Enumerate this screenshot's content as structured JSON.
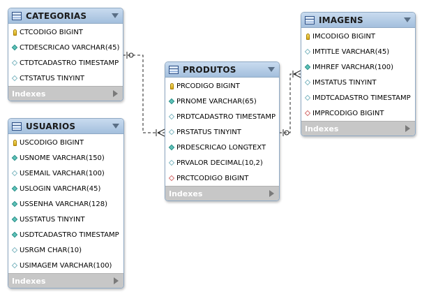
{
  "tables": [
    {
      "id": "categorias",
      "name": "CATEGORIAS",
      "columns": [
        {
          "name": "CTCODIGO BIGINT",
          "kind": "pk"
        },
        {
          "name": "CTDESCRICAO VARCHAR(45)",
          "kind": "nn"
        },
        {
          "name": "CTDTCADASTRO TIMESTAMP",
          "kind": "null"
        },
        {
          "name": "CTSTATUS TINYINT",
          "kind": "null"
        }
      ],
      "footer": "Indexes"
    },
    {
      "id": "usuarios",
      "name": "USUARIOS",
      "columns": [
        {
          "name": "USCODIGO BIGINT",
          "kind": "pk"
        },
        {
          "name": "USNOME VARCHAR(150)",
          "kind": "nn"
        },
        {
          "name": "USEMAIL VARCHAR(100)",
          "kind": "null"
        },
        {
          "name": "USLOGIN VARCHAR(45)",
          "kind": "nn"
        },
        {
          "name": "USSENHA VARCHAR(128)",
          "kind": "nn"
        },
        {
          "name": "USSTATUS TINYINT",
          "kind": "nn"
        },
        {
          "name": "USDTCADASTRO TIMESTAMP",
          "kind": "nn"
        },
        {
          "name": "USRGM CHAR(10)",
          "kind": "null"
        },
        {
          "name": "USIMAGEM VARCHAR(100)",
          "kind": "null"
        }
      ],
      "footer": "Indexes"
    },
    {
      "id": "produtos",
      "name": "PRODUTOS",
      "columns": [
        {
          "name": "PRCODIGO BIGINT",
          "kind": "pk"
        },
        {
          "name": "PRNOME VARCHAR(65)",
          "kind": "nn"
        },
        {
          "name": "PRDTCADASTRO TIMESTAMP",
          "kind": "null"
        },
        {
          "name": "PRSTATUS TINYINT",
          "kind": "null"
        },
        {
          "name": "PRDESCRICAO LONGTEXT",
          "kind": "nn"
        },
        {
          "name": "PRVALOR DECIMAL(10,2)",
          "kind": "null"
        },
        {
          "name": "PRCTCODIGO BIGINT",
          "kind": "fk"
        }
      ],
      "footer": "Indexes"
    },
    {
      "id": "imagens",
      "name": "IMAGENS",
      "columns": [
        {
          "name": "IMCODIGO BIGINT",
          "kind": "pk"
        },
        {
          "name": "IMTITLE VARCHAR(45)",
          "kind": "null"
        },
        {
          "name": "IMHREF VARCHAR(100)",
          "kind": "nn"
        },
        {
          "name": "IMSTATUS TINYINT",
          "kind": "null"
        },
        {
          "name": "IMDTCADASTRO TIMESTAMP",
          "kind": "null"
        },
        {
          "name": "IMPRCODIGO BIGINT",
          "kind": "fk"
        }
      ],
      "footer": "Indexes"
    }
  ],
  "relationships": [
    {
      "from": "categorias",
      "to": "produtos",
      "from_end": "zero-or-one",
      "to_end": "one-or-many",
      "style": "dashed"
    },
    {
      "from": "produtos",
      "to": "imagens",
      "from_end": "zero-or-one",
      "to_end": "one-or-many",
      "style": "dashed"
    }
  ],
  "colors": {
    "header_gradient_top": "#c9dbef",
    "header_gradient_bottom": "#a3bfdd",
    "border": "#8fa9c4",
    "footer_bg": "#c7c7c7",
    "key_icon": "#e6c22a",
    "not_null_diamond": "#5fc3b9",
    "foreign_key_diamond": "#d36f6f",
    "connector": "#222222"
  },
  "icons": {
    "table": "table-icon",
    "collapse": "chevron-down-icon",
    "indexes": "chevron-right-icon",
    "primary_key": "key-icon",
    "not_null": "filled-diamond-icon",
    "nullable": "empty-diamond-icon",
    "foreign_key": "red-diamond-icon"
  }
}
